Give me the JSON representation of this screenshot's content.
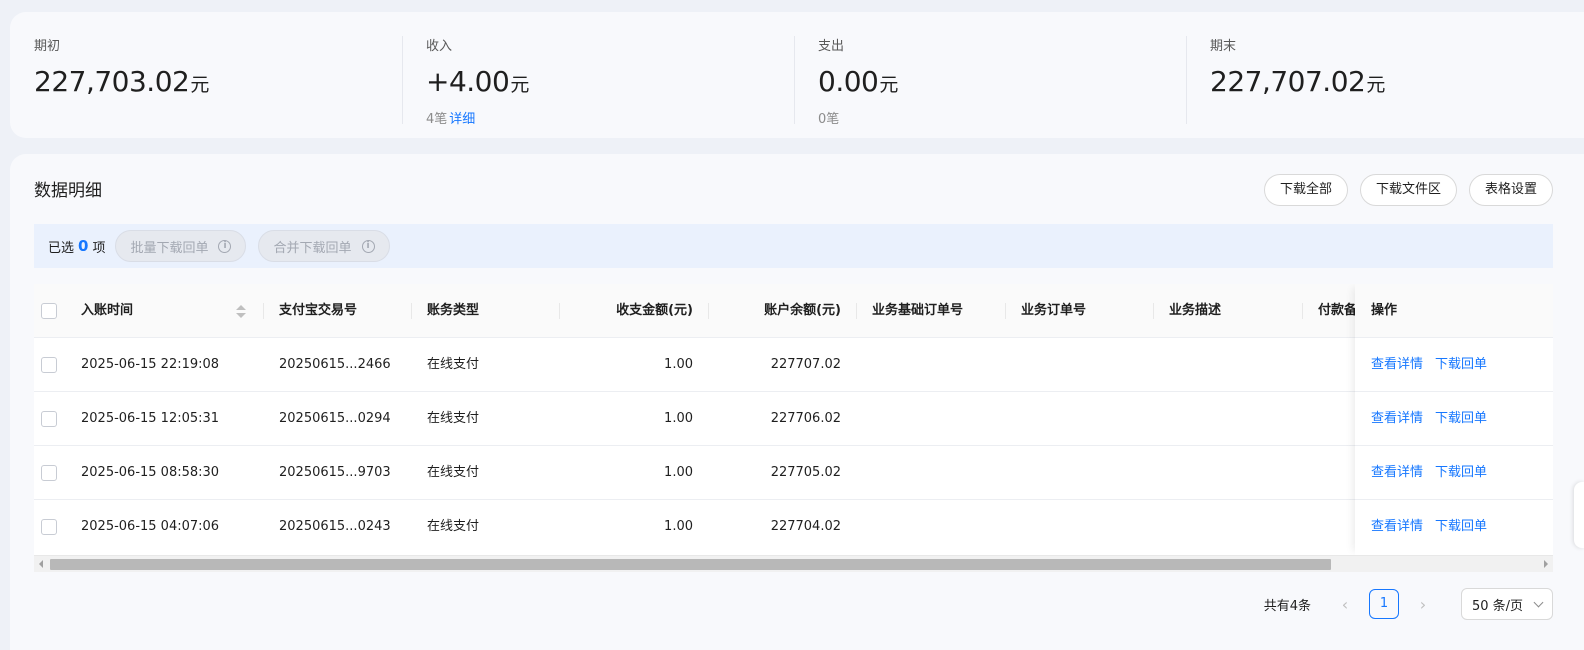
{
  "summary": [
    {
      "label": "期初",
      "value": "227,703.02",
      "unit": "元",
      "sub_count": "",
      "sub_link": ""
    },
    {
      "label": "收入",
      "value": "+4.00",
      "unit": "元",
      "sub_count": "4笔",
      "sub_link": "详细"
    },
    {
      "label": "支出",
      "value": "0.00",
      "unit": "元",
      "sub_count": "0笔",
      "sub_link": ""
    },
    {
      "label": "期末",
      "value": "227,707.02",
      "unit": "元",
      "sub_count": "",
      "sub_link": ""
    }
  ],
  "detail": {
    "title": "数据明细",
    "buttons": {
      "download_all": "下载全部",
      "download_area": "下载文件区",
      "table_settings": "表格设置"
    }
  },
  "selection": {
    "prefix": "已选",
    "count": "0",
    "suffix": "项",
    "batch_download": "批量下载回单",
    "merge_download": "合并下载回单"
  },
  "table": {
    "columns": {
      "time": "入账时间",
      "trade_no": "支付宝交易号",
      "type": "账务类型",
      "amount": "收支金额(元)",
      "balance": "账户余额(元)",
      "base_order": "业务基础订单号",
      "order": "业务订单号",
      "desc": "业务描述",
      "payer": "付款备",
      "actions": "操作"
    },
    "rows": [
      {
        "time": "2025-06-15 22:19:08",
        "trade_no": "20250615...2466",
        "type": "在线支付",
        "amount": "1.00",
        "balance": "227707.02"
      },
      {
        "time": "2025-06-15 12:05:31",
        "trade_no": "20250615...0294",
        "type": "在线支付",
        "amount": "1.00",
        "balance": "227706.02"
      },
      {
        "time": "2025-06-15 08:58:30",
        "trade_no": "20250615...9703",
        "type": "在线支付",
        "amount": "1.00",
        "balance": "227705.02"
      },
      {
        "time": "2025-06-15 04:07:06",
        "trade_no": "20250615...0243",
        "type": "在线支付",
        "amount": "1.00",
        "balance": "227704.02"
      }
    ],
    "action_view": "查看详情",
    "action_download": "下载回单"
  },
  "pagination": {
    "total": "共有4条",
    "current_page": "1",
    "page_size": "50 条/页"
  },
  "colors": {
    "accent": "#1677ff",
    "page_bg": "#eef1f7",
    "card_bg": "#f8f9fc",
    "bar_bg": "#eaf1fd"
  }
}
